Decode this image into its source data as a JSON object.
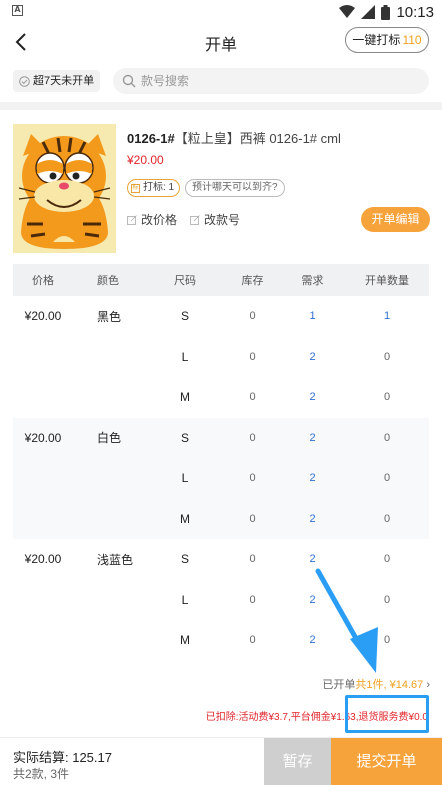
{
  "status_bar": {
    "app_glyph": "A",
    "time": "10:13",
    "icons": [
      "wifi-icon",
      "signal-icon",
      "battery-icon"
    ]
  },
  "header": {
    "title": "开单",
    "one_key_label": "一键打标",
    "one_key_count": "110"
  },
  "filter": {
    "overdue_label": "超7天未开单",
    "search_placeholder": "款号搜索"
  },
  "product": {
    "code": "0126-1#",
    "name": "【粒上皇】西裤 0126-1# cml",
    "price": "¥20.00",
    "mark_label": "打标: 1",
    "ask_label": "预计哪天可以到齐?",
    "edit_price_label": "改价格",
    "edit_code_label": "改款号",
    "open_edit_label": "开单编辑"
  },
  "table": {
    "headers": [
      "价格",
      "颜色",
      "尺码",
      "库存",
      "需求",
      "开单数量"
    ],
    "groups": [
      {
        "price": "¥20.00",
        "color": "黑色",
        "rows": [
          {
            "size": "S",
            "stock": "0",
            "need": "1",
            "qty": "1"
          },
          {
            "size": "L",
            "stock": "0",
            "need": "2",
            "qty": "0"
          },
          {
            "size": "M",
            "stock": "0",
            "need": "2",
            "qty": "0"
          }
        ]
      },
      {
        "price": "¥20.00",
        "color": "白色",
        "rows": [
          {
            "size": "S",
            "stock": "0",
            "need": "2",
            "qty": "0"
          },
          {
            "size": "L",
            "stock": "0",
            "need": "2",
            "qty": "0"
          },
          {
            "size": "M",
            "stock": "0",
            "need": "2",
            "qty": "0"
          }
        ]
      },
      {
        "price": "¥20.00",
        "color": "浅蓝色",
        "rows": [
          {
            "size": "S",
            "stock": "0",
            "need": "2",
            "qty": "0"
          },
          {
            "size": "L",
            "stock": "0",
            "need": "2",
            "qty": "0"
          },
          {
            "size": "M",
            "stock": "0",
            "need": "2",
            "qty": "0"
          }
        ]
      }
    ]
  },
  "summary": {
    "opened_prefix": "已开单",
    "opened_count": "共1件,",
    "opened_amount": "¥14.67",
    "chevron": "›",
    "deduct": "已扣除:活动费¥3.7,平台佣金¥1.63,退货服务费¥0.0"
  },
  "bottom": {
    "settle_label": "实际结算: 125.17",
    "settle_sub": "共2款, 3件",
    "save_label": "暂存",
    "submit_label": "提交开单"
  },
  "colors": {
    "accent": "#f7a33c",
    "price_red": "#e0252b",
    "link_blue": "#2f6fd0",
    "annotation_blue": "#2a9df4"
  }
}
